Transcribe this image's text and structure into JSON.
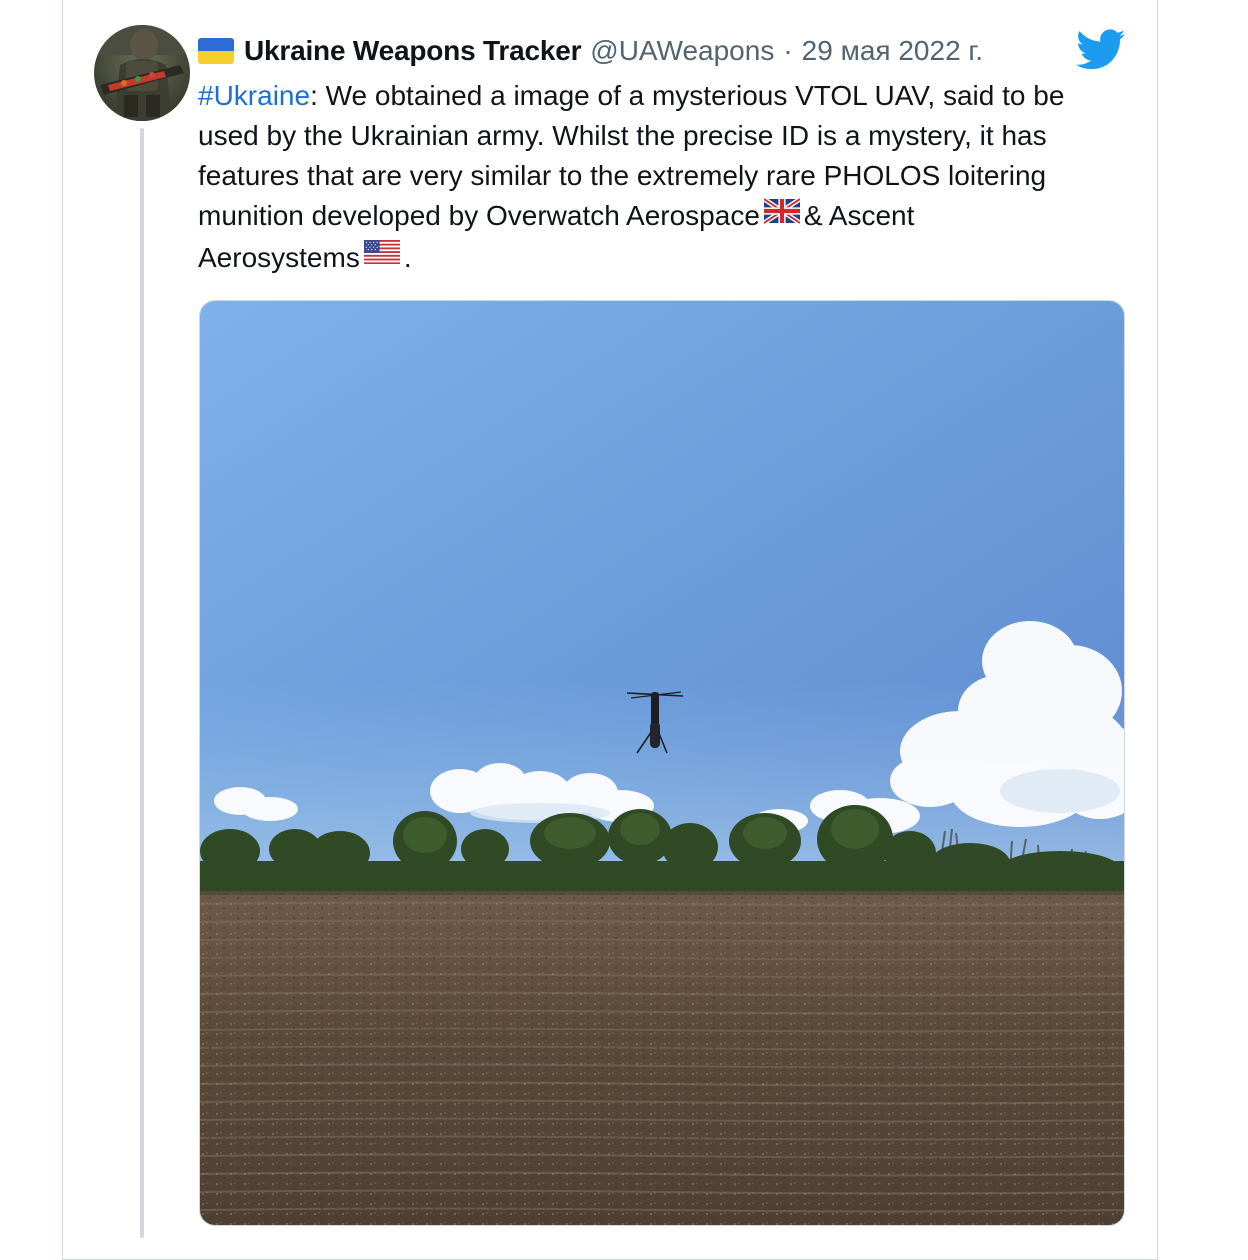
{
  "tweet": {
    "author": {
      "display_name": "Ukraine Weapons Tracker",
      "handle": "@UAWeapons",
      "name_flag": "ukraine-flag",
      "avatar": "soldier-avatar"
    },
    "separator": "·",
    "date": "29 мая 2022 г.",
    "platform_icon": "twitter-bird-icon",
    "brand_color": "#1d9bf0",
    "hashtag_color": "#1d6fd8",
    "text": {
      "line1_hashtag": "#Ukraine",
      "line1_rest": ": We obtained a image of a mysterious VTOL UAV, said to be",
      "line2": "used by the Ukrainian army. Whilst the precise ID is a mystery, it has",
      "line3": "features that are very similar to the extremely rare PHOLOS loitering",
      "line4_before_flag": "munition developed by Overwatch Aerospace",
      "line4_flag": "uk-flag",
      "line4_after_flag": "& Ascent",
      "line5_before_flag": "Aerosystems",
      "line5_flag": "us-flag",
      "line5_after_flag": "."
    },
    "media": {
      "subject": "VTOL UAV hovering over a ploughed field under blue sky",
      "icon": "photo"
    }
  }
}
